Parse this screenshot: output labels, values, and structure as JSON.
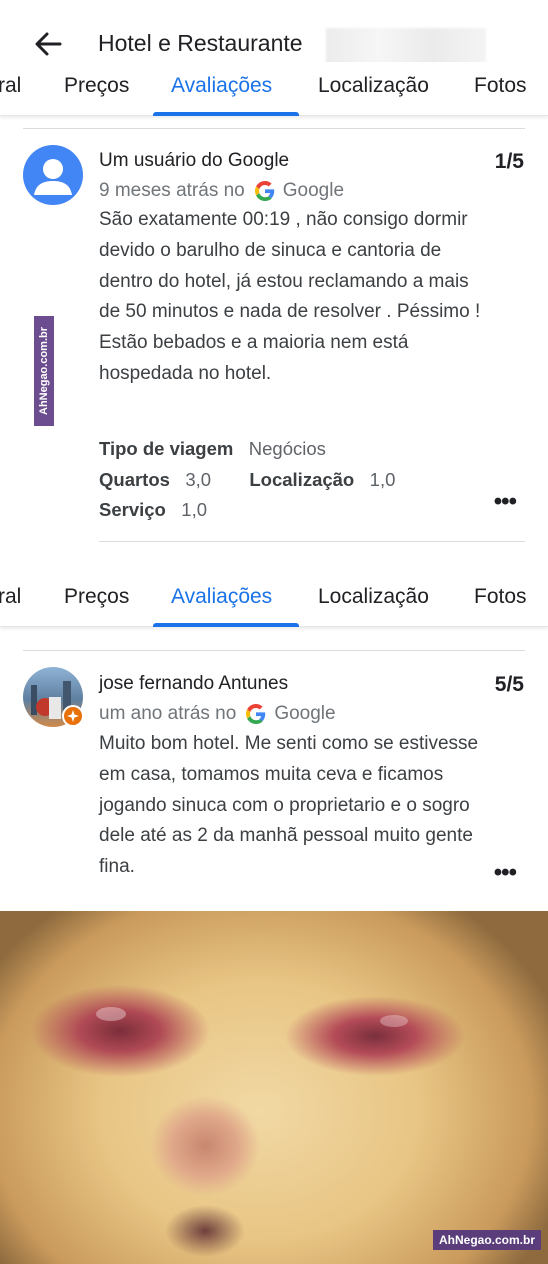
{
  "header": {
    "title": "Hotel e Restaurante"
  },
  "tabs": [
    {
      "label": "ral"
    },
    {
      "label": "Preços"
    },
    {
      "label": "Avaliações",
      "active": true
    },
    {
      "label": "Localização"
    },
    {
      "label": "Fotos"
    }
  ],
  "review1": {
    "reviewer": "Um usuário do Google",
    "score": "1/5",
    "time": "9 meses atrás no",
    "source": "Google",
    "text": "São exatamente 00:19 , não consigo dormir devido o barulho de sinuca e cantoria de dentro do hotel, já estou reclamando a mais de 50 minutos e nada de resolver . Péssimo ! Estão bebados e a maioria nem está hospedada no hotel.",
    "trip_type_label": "Tipo de viagem",
    "trip_type_value": "Negócios",
    "rooms_label": "Quartos",
    "rooms_value": "3,0",
    "location_label": "Localização",
    "location_value": "1,0",
    "service_label": "Serviço",
    "service_value": "1,0",
    "more": "•••"
  },
  "review2": {
    "reviewer": "jose fernando Antunes",
    "score": "5/5",
    "time": "um ano atrás no",
    "source": "Google",
    "text": "Muito bom hotel. Me senti como se estivesse em casa, tomamos muita ceva e ficamos jogando sinuca com o proprietario e o sogro dele até as 2 da manhã pessoal muito gente fina.",
    "more": "•••"
  },
  "watermark": "AhNegao.com.br",
  "colors": {
    "accent": "#1a73e8",
    "avatar_blue": "#4285f4",
    "watermark_purple": "#5a3d7a"
  }
}
